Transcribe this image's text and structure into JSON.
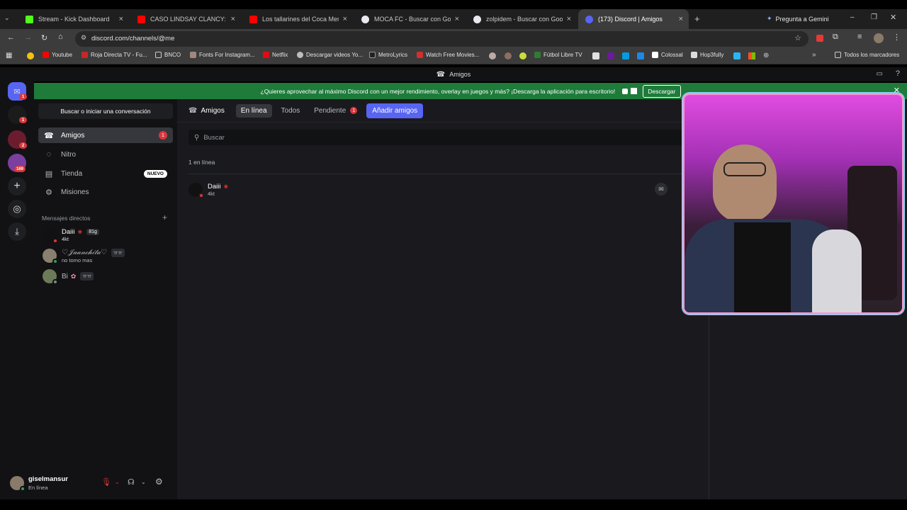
{
  "browser": {
    "tabs": [
      {
        "title": "Stream - Kick Dashboard",
        "color": "#53fc18"
      },
      {
        "title": "CASO LINDSAY CLANCY: ¿Cola...",
        "color": "#ff0000"
      },
      {
        "title": "Los tallarines del Coca Mendoz...",
        "color": "#ff0000"
      },
      {
        "title": "MOCA FC - Buscar con Google",
        "color": "#e8eaed"
      },
      {
        "title": "zolpidem - Buscar con Google",
        "color": "#e8eaed"
      },
      {
        "title": "(173) Discord | Amigos",
        "color": "#5865f2"
      }
    ],
    "gemini": "Pregunta a Gemini",
    "url": "discord.com/channels/@me",
    "bookmarks": [
      "Youtube",
      "Roja Directa TV - Fu...",
      "BNCO",
      "Fonts For Instagram...",
      "Netflix",
      "Descargar videos Yo...",
      "MetroLyrics",
      "Watch Free Movies...",
      "Fútbol Libre TV",
      "Colossal",
      "Hop3fully"
    ],
    "all_bookmarks": "Todos los marcadores"
  },
  "discord": {
    "window_title": "Amigos",
    "guild_badges": [
      "1",
      "1",
      "2",
      "169"
    ],
    "banner": {
      "text": "¿Quieres aprovechar al máximo Discord con un mejor rendimiento, overlay en juegos y más? ¡Descarga la aplicación para escritorio!",
      "button": "Descargar"
    },
    "sidebar": {
      "search": "Buscar o iniciar una conversación",
      "nav": [
        {
          "label": "Amigos",
          "badge": "1"
        },
        {
          "label": "Nitro"
        },
        {
          "label": "Tienda",
          "tag": "NUEVO"
        },
        {
          "label": "Misiones"
        }
      ],
      "dm_header": "Mensajes directos",
      "dms": [
        {
          "name": "Daiii",
          "tag": "81g",
          "status_text": "4kt"
        },
        {
          "name": "♡𝒥𝓊𝒶𝓃𝒸𝒽𝒾𝓉𝒶♡",
          "tag": "ㅠㅠ",
          "status_text": "no tomo mas"
        },
        {
          "name": "Bi",
          "tag": "ㅠㅠ",
          "status_text": ""
        }
      ]
    },
    "friends": {
      "title": "Amigos",
      "tabs": [
        "En línea",
        "Todos",
        "Pendiente"
      ],
      "pending_badge": "1",
      "add_button": "Añadir amigos",
      "search_placeholder": "Buscar",
      "online_count": "1 en línea",
      "list": [
        {
          "name": "Daiii",
          "status_text": "4kt"
        }
      ]
    },
    "user": {
      "name": "giselmansur",
      "status": "En línea"
    }
  }
}
